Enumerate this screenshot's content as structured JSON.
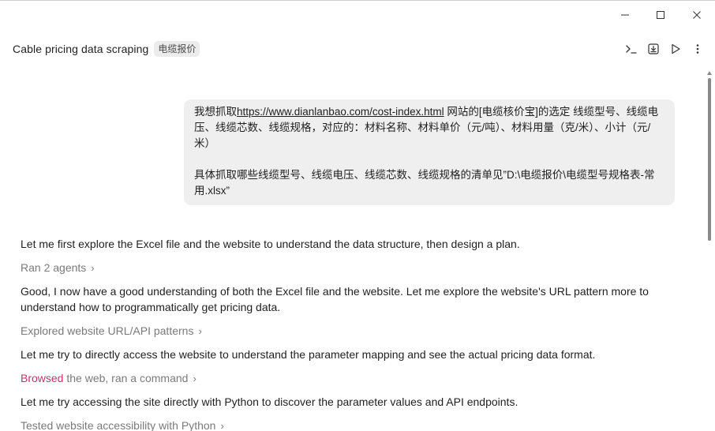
{
  "window": {
    "minimize_icon": "minimize-icon",
    "maximize_icon": "maximize-icon",
    "close_icon": "close-icon"
  },
  "header": {
    "title": "Cable pricing data scraping",
    "tag": "电缆报价",
    "actions": [
      "terminal-icon",
      "download-icon",
      "play-icon",
      "more-vertical-icon"
    ]
  },
  "user_message": {
    "prefix": "我想抓取",
    "url": "https://www.dianlanbao.com/cost-index.html",
    "line1_rest": " 网站的[电缆核价宝]的选定 线缆型号、线缆电压、线缆芯数、线缆规格，对应的：材料名称、材料单价（元/吨）、材料用量（克/米）、小计（元/米）",
    "paragraph2": "具体抓取哪些线缆型号、线缆电压、线缆芯数、线缆规格的清单见”D:\\电缆报价\\电缆型号规格表-常用.xlsx”"
  },
  "assistant": {
    "msg1": "Let me first explore the Excel file and the website to understand the data structure, then design a plan.",
    "step1": "Ran 2 agents",
    "msg2": "Good, I now have a good understanding of both the Excel file and the website. Let me explore the website's URL pattern more to understand how to programmatically get pricing data.",
    "step2": "Explored website URL/API patterns",
    "msg3": "Let me try to directly access the website to understand the parameter mapping and see the actual pricing data format.",
    "step3_accent": "Browsed",
    "step3_rest": " the web, ran a command",
    "msg4": "Let me try accessing the site directly with Python to discover the parameter values and API endpoints.",
    "step4": "Tested website accessibility with Python",
    "chevron": "›"
  },
  "colors": {
    "accent": "#c8326b",
    "bubble": "#efefef",
    "muted": "#7a7a7a"
  }
}
